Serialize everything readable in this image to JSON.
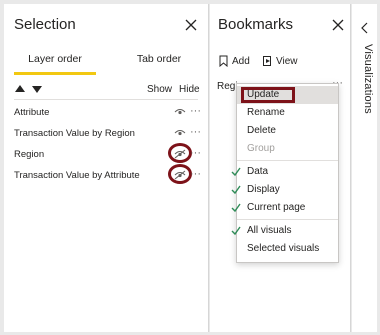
{
  "selection": {
    "title": "Selection",
    "tabs": [
      "Layer order",
      "Tab order"
    ],
    "active_tab": "Layer order",
    "controls": {
      "show": "Show",
      "hide": "Hide"
    },
    "layers": [
      {
        "label": "Attribute",
        "hidden": false
      },
      {
        "label": "Transaction Value by Region",
        "hidden": false
      },
      {
        "label": "Region",
        "hidden": true
      },
      {
        "label": "Transaction Value by Attribute",
        "hidden": true
      }
    ]
  },
  "bookmarks": {
    "title": "Bookmarks",
    "add_label": "Add",
    "view_label": "View",
    "item_label": "Region",
    "menu": {
      "items": [
        {
          "label": "Update",
          "checked": false,
          "disabled": false
        },
        {
          "label": "Rename",
          "checked": false,
          "disabled": false
        },
        {
          "label": "Delete",
          "checked": false,
          "disabled": false
        },
        {
          "label": "Group",
          "checked": false,
          "disabled": true
        },
        {
          "label": "Data",
          "checked": true,
          "disabled": false
        },
        {
          "label": "Display",
          "checked": true,
          "disabled": false
        },
        {
          "label": "Current page",
          "checked": true,
          "disabled": false
        },
        {
          "label": "All visuals",
          "checked": true,
          "disabled": false
        },
        {
          "label": "Selected visuals",
          "checked": false,
          "disabled": false
        }
      ]
    }
  },
  "visualizations": {
    "title": "Visualizations"
  },
  "colors": {
    "accent_underline": "#f2c811",
    "highlight_ring": "#7d1219",
    "check": "#2e8b57"
  },
  "icons": [
    "close-icon",
    "arrow-up-icon",
    "arrow-down-icon",
    "eye-icon",
    "eye-hidden-icon",
    "more-options-icon",
    "bookmark-add-icon",
    "view-icon",
    "chevron-left-icon",
    "check-icon"
  ]
}
